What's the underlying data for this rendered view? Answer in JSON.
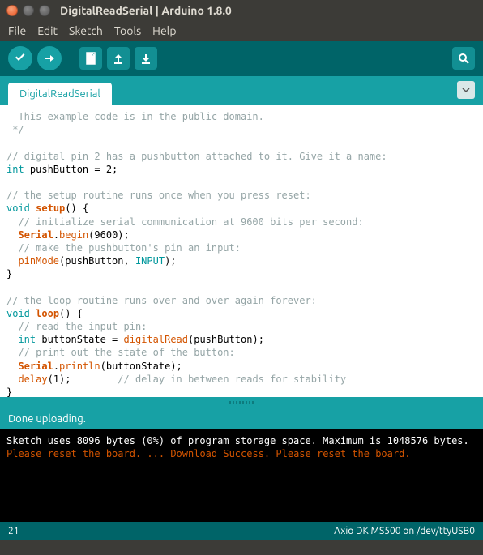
{
  "window": {
    "title": "DigitalReadSerial | Arduino 1.8.0"
  },
  "menu": {
    "file": "File",
    "edit": "Edit",
    "sketch": "Sketch",
    "tools": "Tools",
    "help": "Help"
  },
  "tab": {
    "name": "DigitalReadSerial"
  },
  "code": {
    "l1": "  This example code is in the public domain.",
    "l2": " */",
    "l3": "// digital pin 2 has a pushbutton attached to it. Give it a name:",
    "l4_kw": "int",
    "l4_rest": " pushButton = 2;",
    "l5": "// the setup routine runs once when you press reset:",
    "l6_kw": "void",
    "l6_fn": "setup",
    "l6_rest": "() {",
    "l7": "  // initialize serial communication at 9600 bits per second:",
    "l8_cls": "Serial",
    "l8_dot": ".",
    "l8_fn": "begin",
    "l8_rest": "(9600);",
    "l9": "  // make the pushbutton's pin an input:",
    "l10_fn": "pinMode",
    "l10_mid": "(pushButton, ",
    "l10_const": "INPUT",
    "l10_end": ");",
    "l11": "}",
    "l12": "// the loop routine runs over and over again forever:",
    "l13_kw": "void",
    "l13_fn": "loop",
    "l13_rest": "() {",
    "l14": "  // read the input pin:",
    "l15_kw": "int",
    "l15_mid": " buttonState = ",
    "l15_fn": "digitalRead",
    "l15_rest": "(pushButton);",
    "l16": "  // print out the state of the button:",
    "l17_cls": "Serial",
    "l17_dot": ".",
    "l17_fn": "println",
    "l17_rest": "(buttonState);",
    "l18_fn": "delay",
    "l18_mid": "(1);",
    "l18_cmt": "        // delay in between reads for stability",
    "l19": "}"
  },
  "status": {
    "message": "Done uploading."
  },
  "console": {
    "l1": "Sketch uses 8096 bytes (0%) of program storage space. Maximum is 1048576 bytes.",
    "l2": "Please reset the board.",
    "l3": "...",
    "l4": "Download Success.",
    "l5": "Please reset the board."
  },
  "footer": {
    "line": "21",
    "board": "Axio DK MS500 on /dev/ttyUSB0"
  }
}
